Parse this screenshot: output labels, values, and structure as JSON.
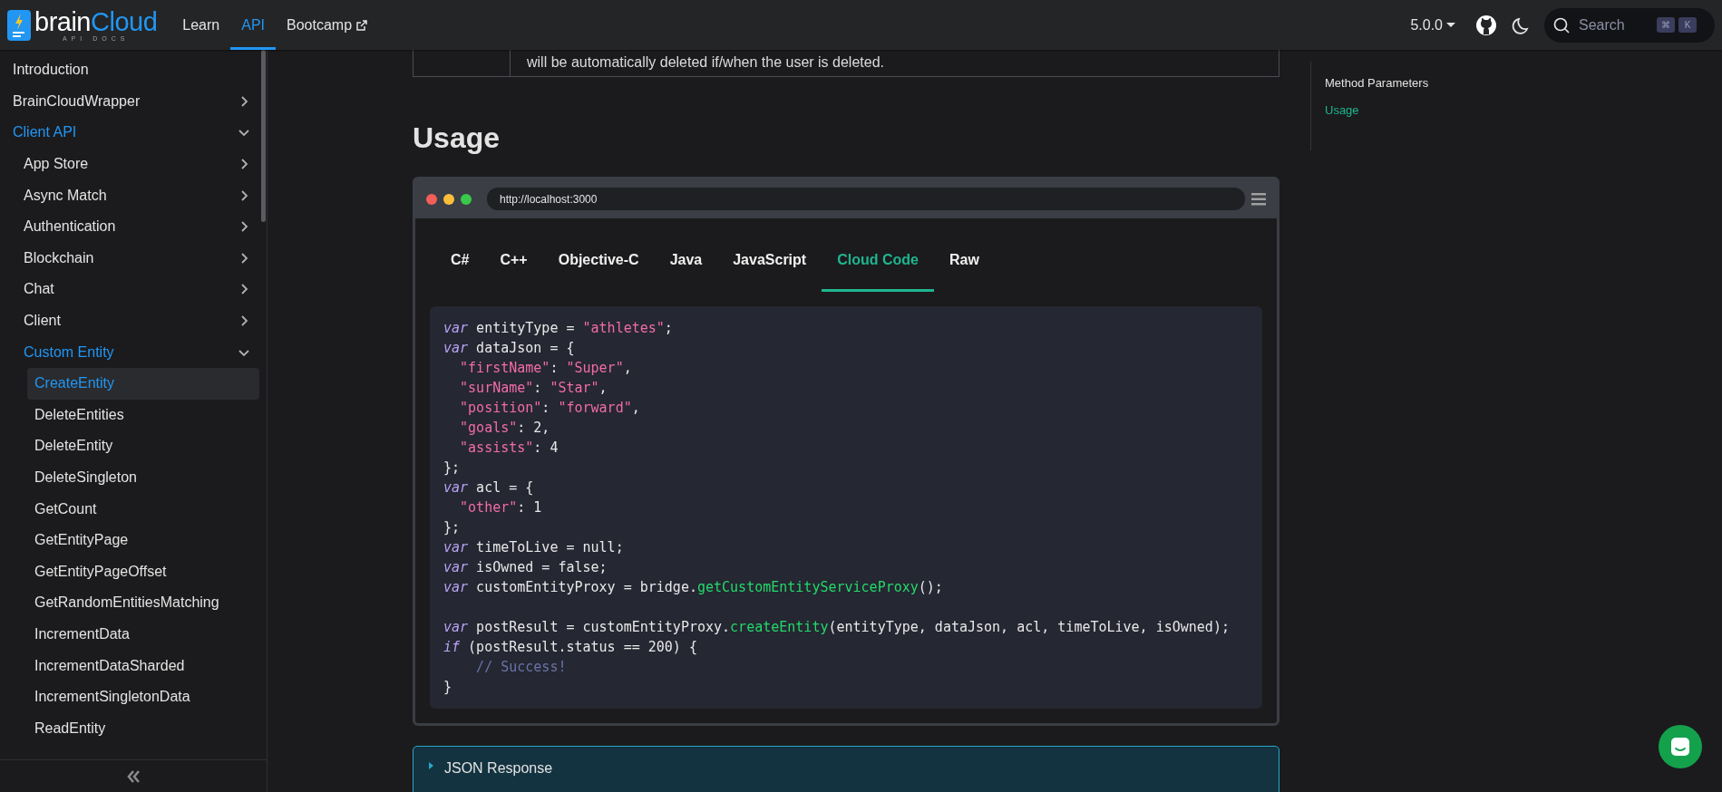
{
  "navbar": {
    "logo": {
      "name": "brain",
      "accent": "Cloud",
      "subtitle": "API DOCS"
    },
    "links": [
      {
        "label": "Learn",
        "selected": false,
        "external": false
      },
      {
        "label": "API",
        "selected": true,
        "external": false
      },
      {
        "label": "Bootcamp",
        "selected": false,
        "external": true
      }
    ],
    "version": "5.0.0",
    "search": {
      "placeholder": "Search",
      "keys": [
        "⌘",
        "K"
      ]
    }
  },
  "sidebar": {
    "items": [
      {
        "label": "Introduction",
        "selected": false,
        "active": false
      },
      {
        "label": "BrainCloudWrapper",
        "selected": false,
        "active": false,
        "expanded": false
      },
      {
        "label": "Client API",
        "selected": false,
        "active": true,
        "expanded": true,
        "children": [
          {
            "label": "App Store",
            "selected": false,
            "active": false,
            "expanded": false
          },
          {
            "label": "Async Match",
            "selected": false,
            "active": false,
            "expanded": false
          },
          {
            "label": "Authentication",
            "selected": false,
            "active": false,
            "expanded": false
          },
          {
            "label": "Blockchain",
            "selected": false,
            "active": false,
            "expanded": false
          },
          {
            "label": "Chat",
            "selected": false,
            "active": false,
            "expanded": false
          },
          {
            "label": "Client",
            "selected": false,
            "active": false,
            "expanded": false
          },
          {
            "label": "Custom Entity",
            "selected": false,
            "active": true,
            "expanded": true,
            "children": [
              {
                "label": "CreateEntity",
                "selected": true,
                "active": true
              },
              {
                "label": "DeleteEntities",
                "selected": false,
                "active": false
              },
              {
                "label": "DeleteEntity",
                "selected": false,
                "active": false
              },
              {
                "label": "DeleteSingleton",
                "selected": false,
                "active": false
              },
              {
                "label": "GetCount",
                "selected": false,
                "active": false
              },
              {
                "label": "GetEntityPage",
                "selected": false,
                "active": false
              },
              {
                "label": "GetEntityPageOffset",
                "selected": false,
                "active": false
              },
              {
                "label": "GetRandomEntitiesMatching",
                "selected": false,
                "active": false
              },
              {
                "label": "IncrementData",
                "selected": false,
                "active": false
              },
              {
                "label": "IncrementDataSharded",
                "selected": false,
                "active": false
              },
              {
                "label": "IncrementSingletonData",
                "selected": false,
                "active": false
              },
              {
                "label": "ReadEntity",
                "selected": false,
                "active": false
              }
            ]
          }
        ]
      }
    ]
  },
  "table_row": {
    "cell": "will be automatically deleted if/when the user is deleted."
  },
  "heading": "Usage",
  "browser": {
    "url": "http://localhost:3000",
    "tabs": [
      {
        "label": "C#",
        "selected": false
      },
      {
        "label": "C++",
        "selected": false
      },
      {
        "label": "Objective-C",
        "selected": false
      },
      {
        "label": "Java",
        "selected": false
      },
      {
        "label": "JavaScript",
        "selected": false
      },
      {
        "label": "Cloud Code",
        "selected": true
      },
      {
        "label": "Raw",
        "selected": false
      }
    ],
    "code_lines": [
      {
        "kind": "plain",
        "tokens": [
          {
            "kind": "keyword",
            "text": "var"
          },
          {
            "kind": "plain",
            "text": " entityType = "
          },
          {
            "kind": "string",
            "text": "\"athletes\""
          },
          {
            "kind": "plain",
            "text": ";"
          }
        ]
      },
      {
        "kind": "plain",
        "tokens": [
          {
            "kind": "keyword",
            "text": "var"
          },
          {
            "kind": "plain",
            "text": " dataJson = {"
          }
        ]
      },
      {
        "kind": "indented",
        "tokens": [
          {
            "kind": "string",
            "text": "\"firstName\""
          },
          {
            "kind": "plain",
            "text": ": "
          },
          {
            "kind": "string",
            "text": "\"Super\""
          },
          {
            "kind": "plain",
            "text": ","
          }
        ]
      },
      {
        "kind": "indented",
        "tokens": [
          {
            "kind": "string",
            "text": "\"surName\""
          },
          {
            "kind": "plain",
            "text": ": "
          },
          {
            "kind": "string",
            "text": "\"Star\""
          },
          {
            "kind": "plain",
            "text": ","
          }
        ]
      },
      {
        "kind": "indented",
        "tokens": [
          {
            "kind": "string",
            "text": "\"position\""
          },
          {
            "kind": "plain",
            "text": ": "
          },
          {
            "kind": "string",
            "text": "\"forward\""
          },
          {
            "kind": "plain",
            "text": ","
          }
        ]
      },
      {
        "kind": "indented",
        "tokens": [
          {
            "kind": "string",
            "text": "\"goals\""
          },
          {
            "kind": "plain",
            "text": ": 2,"
          }
        ]
      },
      {
        "kind": "indented",
        "tokens": [
          {
            "kind": "string",
            "text": "\"assists\""
          },
          {
            "kind": "plain",
            "text": ": 4"
          }
        ]
      },
      {
        "kind": "plain",
        "tokens": [
          {
            "kind": "plain",
            "text": "};"
          }
        ]
      },
      {
        "kind": "plain",
        "tokens": [
          {
            "kind": "keyword",
            "text": "var"
          },
          {
            "kind": "plain",
            "text": " acl = {"
          }
        ]
      },
      {
        "kind": "indented",
        "tokens": [
          {
            "kind": "string",
            "text": "\"other\""
          },
          {
            "kind": "plain",
            "text": ": 1"
          }
        ]
      },
      {
        "kind": "plain",
        "tokens": [
          {
            "kind": "plain",
            "text": "};"
          }
        ]
      },
      {
        "kind": "plain",
        "tokens": [
          {
            "kind": "keyword",
            "text": "var"
          },
          {
            "kind": "plain",
            "text": " timeToLive = null;"
          }
        ]
      },
      {
        "kind": "plain",
        "tokens": [
          {
            "kind": "keyword",
            "text": "var"
          },
          {
            "kind": "plain",
            "text": " isOwned = false;"
          }
        ]
      },
      {
        "kind": "plain",
        "tokens": [
          {
            "kind": "keyword",
            "text": "var"
          },
          {
            "kind": "plain",
            "text": " customEntityProxy = bridge."
          },
          {
            "kind": "function",
            "text": "getCustomEntityServiceProxy"
          },
          {
            "kind": "plain",
            "text": "();"
          }
        ]
      },
      {
        "kind": "blank"
      },
      {
        "kind": "plain",
        "tokens": [
          {
            "kind": "keyword",
            "text": "var"
          },
          {
            "kind": "plain",
            "text": " postResult = customEntityProxy."
          },
          {
            "kind": "function",
            "text": "createEntity"
          },
          {
            "kind": "plain",
            "text": "(entityType, dataJson, acl, timeToLive, isOwned);"
          }
        ]
      },
      {
        "kind": "plain",
        "tokens": [
          {
            "kind": "keyword",
            "text": "if"
          },
          {
            "kind": "plain",
            "text": " (postResult.status == 200) {"
          }
        ]
      },
      {
        "kind": "nested",
        "tokens": [
          {
            "kind": "comment",
            "text": "// Success!"
          }
        ]
      },
      {
        "kind": "plain",
        "tokens": [
          {
            "kind": "plain",
            "text": "}"
          }
        ]
      }
    ]
  },
  "details": {
    "summary": "JSON Response",
    "expanded": false
  },
  "toc": [
    {
      "label": "Method Parameters",
      "selected": false
    },
    {
      "label": "Usage",
      "selected": true
    }
  ]
}
